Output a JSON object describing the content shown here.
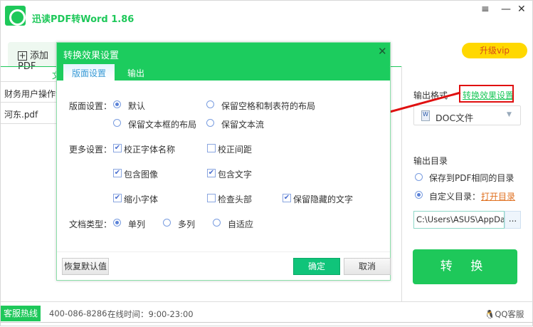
{
  "app": {
    "title": "迅读PDF转Word 1.86",
    "add_tab": "添加PDF",
    "vip": "升级vip"
  },
  "list": {
    "header": "文",
    "rows": [
      "财务用户操作说",
      "河东.pdf"
    ]
  },
  "right": {
    "format_label": "输出格式",
    "effect_link": "转换效果设置",
    "format_value": "DOC文件",
    "dir_label": "输出目录",
    "dir_same": "保存到PDF相同的目录",
    "dir_custom": "自定义目录：",
    "open_dir": "打开目录",
    "path": "C:\\Users\\ASUS\\AppDat",
    "browse": "...",
    "convert": "转 换"
  },
  "footer": {
    "hotline": "客服热线",
    "phone": "400-086-8286",
    "hours": "在线时间：9:00-23:00",
    "qq": "QQ客服"
  },
  "dialog": {
    "title": "转换效果设置",
    "close": "✕",
    "tabs": [
      "版面设置",
      "输出"
    ],
    "layout_label": "版面设置：",
    "layout_options": [
      "默认",
      "保留空格和制表符的布局",
      "保留文本框的布局",
      "保留文本流"
    ],
    "layout_selected": 0,
    "more_label": "更多设置：",
    "checkboxes": [
      {
        "label": "校正字体名称",
        "checked": true
      },
      {
        "label": "校正间距",
        "checked": false
      },
      {
        "label": "包含图像",
        "checked": true
      },
      {
        "label": "包含文字",
        "checked": true
      },
      {
        "label": "缩小字体",
        "checked": true
      },
      {
        "label": "检查头部",
        "checked": false
      },
      {
        "label": "保留隐藏的文字",
        "checked": true
      }
    ],
    "doctype_label": "文档类型：",
    "doctype_options": [
      "单列",
      "多列",
      "自适应"
    ],
    "doctype_selected": 0,
    "restore": "恢复默认值",
    "ok": "确定",
    "cancel": "取消"
  },
  "colors": {
    "brand": "#1ec85a",
    "annotation": "#e01010"
  }
}
